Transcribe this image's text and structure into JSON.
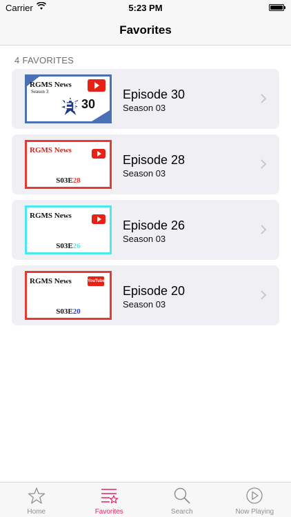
{
  "status_bar": {
    "carrier": "Carrier",
    "time": "5:23 PM"
  },
  "nav": {
    "title": "Favorites"
  },
  "section": {
    "header": "4 FAVORITES"
  },
  "episodes": [
    {
      "title": "Episode 30",
      "season": "Season 03",
      "thumb": {
        "brand": "RGMS News",
        "sub": "Season 3",
        "ep": "Ep",
        "num": "30"
      }
    },
    {
      "title": "Episode 28",
      "season": "Season 03",
      "thumb": {
        "brand": "RGMS News",
        "code_prefix": "S03E",
        "code_num": "28"
      }
    },
    {
      "title": "Episode 26",
      "season": "Season 03",
      "thumb": {
        "brand": "RGMS News",
        "code_prefix": "S03E",
        "code_num": "26"
      }
    },
    {
      "title": "Episode 20",
      "season": "Season 03",
      "thumb": {
        "brand": "RGMS News",
        "code_prefix": "S03E",
        "code_num": "20",
        "logo": "YouTube"
      }
    }
  ],
  "tabs": [
    {
      "label": "Home",
      "icon": "star-icon"
    },
    {
      "label": "Favorites",
      "icon": "favorites-list-icon",
      "active": true
    },
    {
      "label": "Search",
      "icon": "search-icon"
    },
    {
      "label": "Now Playing",
      "icon": "play-circle-icon"
    }
  ],
  "colors": {
    "accent": "#e0245e",
    "inactive": "#8e8e93",
    "card_bg": "#efeff4"
  }
}
